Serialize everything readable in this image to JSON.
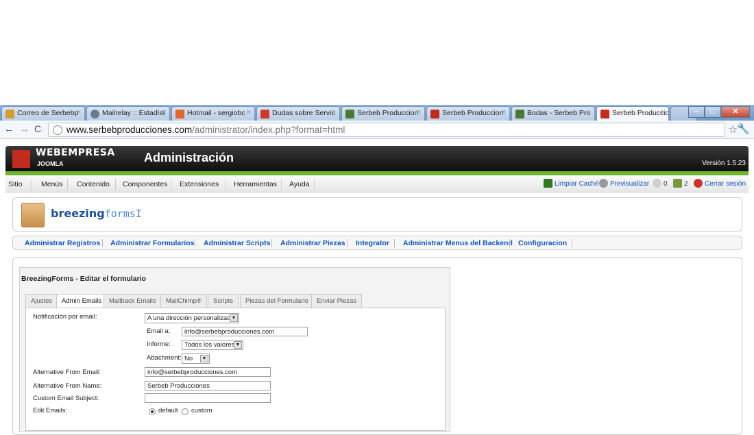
{
  "browser": {
    "tabs": [
      {
        "title": "Correo de Serbebp",
        "color": "#d89b30"
      },
      {
        "title": "Mailrelay :: Estadíst",
        "color": "#6b7b8c"
      },
      {
        "title": "Hotmail - sergiobc",
        "color": "#e0662a"
      },
      {
        "title": "Dudas sobre Servic",
        "color": "#d03a2a"
      },
      {
        "title": "Serbeb Produccion",
        "color": "#4a7a32"
      },
      {
        "title": "Serbeb Produccion",
        "color": "#c32b1c"
      },
      {
        "title": "Bodas - Serbeb Pro",
        "color": "#4a7a32"
      },
      {
        "title": "Serbeb Produccion",
        "color": "#c32b1c"
      }
    ],
    "url_domain": "www.serbebproducciones.com",
    "url_path": "/administrator/index.php?format=html"
  },
  "header": {
    "logo_top": "WEBEMPRESA",
    "logo_bottom": "JOOMLA",
    "title": "Administración",
    "version": "Versión 1.5.23"
  },
  "menu": {
    "items": [
      "Sitio",
      "Menús",
      "Contenido",
      "Componentes",
      "Extensiones",
      "Herramientas",
      "Ayuda"
    ],
    "right": {
      "cache": "Limpiar Caché",
      "preview": "Previsualizar",
      "messages": "0",
      "users": "2",
      "logout": "Cerrar sesión"
    }
  },
  "logo": {
    "brand_bold": "breezing",
    "brand_thin": "forms"
  },
  "submenu": [
    "Administrar Registros",
    "Administrar Formularios",
    "Administrar Scripts",
    "Administrar Piezas",
    "Integrator",
    "Administrar Menus del Backend",
    "Configuracion"
  ],
  "editor": {
    "title": "BreezingForms - Editar el formulario",
    "tabs": [
      "Ajustes",
      "Admin Emails",
      "Mailback Emails",
      "MailChimp®",
      "Scripts",
      "Piezas del Formulario",
      "Enviar Piezas"
    ],
    "active_tab": "Admin Emails",
    "fields": {
      "notification_label": "Notificación por email:",
      "notification_value": "A una dirección personalizada",
      "email_label": "Email a:",
      "email_value": "info@serbebproducciones.com",
      "report_label": "Informe:",
      "report_value": "Todos los valores",
      "attachment_label": "Attachment:",
      "attachment_value": "No",
      "alt_from_email_label": "Alternative From Email:",
      "alt_from_email_value": "info@serbebproducciones.com",
      "alt_from_name_label": "Alternative From Name:",
      "alt_from_name_value": "Serbeb Producciones",
      "custom_subject_label": "Custom Email Subject:",
      "custom_subject_value": "",
      "edit_emails_label": "Edit Emails:",
      "edit_default": "default",
      "edit_custom": "custom",
      "edit_selected": "default"
    }
  }
}
